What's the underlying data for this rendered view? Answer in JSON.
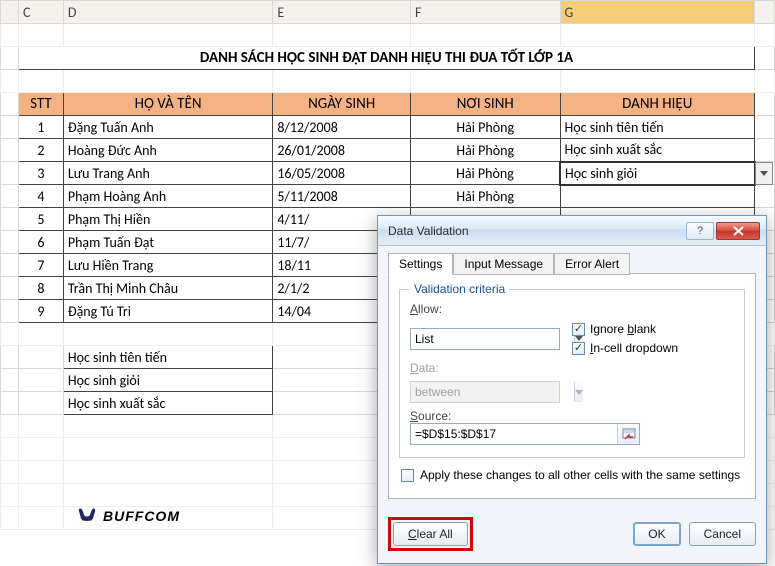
{
  "columns": {
    "C": "C",
    "D": "D",
    "E": "E",
    "F": "F",
    "G": "G"
  },
  "title": "DANH SÁCH HỌC SINH ĐẠT DANH HIỆU THI ĐUA TỐT LỚP 1A",
  "headers": {
    "stt": "STT",
    "name": "HỌ VÀ TÊN",
    "dob": "NGÀY SINH",
    "pob": "NƠI SINH",
    "award": "DANH HIỆU"
  },
  "rows": [
    {
      "stt": "1",
      "name": "Đặng Tuấn Anh",
      "dob": "8/12/2008",
      "pob": "Hải Phòng",
      "award": "Học sinh tiên tiến"
    },
    {
      "stt": "2",
      "name": "Hoàng Đức Anh",
      "dob": "26/01/2008",
      "pob": "Hải Phòng",
      "award": "Học sinh xuất sắc"
    },
    {
      "stt": "3",
      "name": "Lưu Trang Anh",
      "dob": "16/05/2008",
      "pob": "Hải Phòng",
      "award": "Học sinh giỏi"
    },
    {
      "stt": "4",
      "name": "Phạm Hoàng Anh",
      "dob": "5/11/2008",
      "pob": "Hải Phòng",
      "award": ""
    },
    {
      "stt": "5",
      "name": "Phạm Thị Hiền",
      "dob": "4/11/",
      "pob": "",
      "award": ""
    },
    {
      "stt": "6",
      "name": "Phạm Tuấn Đạt",
      "dob": "11/7/",
      "pob": "",
      "award": ""
    },
    {
      "stt": "7",
      "name": "Lưu Hiền Trang",
      "dob": "18/11",
      "pob": "",
      "award": ""
    },
    {
      "stt": "8",
      "name": "Trần Thị Minh Châu",
      "dob": "2/1/2",
      "pob": "",
      "award": ""
    },
    {
      "stt": "9",
      "name": "Đặng Tú Tri",
      "dob": "14/04",
      "pob": "",
      "award": ""
    }
  ],
  "list": [
    "Học sinh tiên tiến",
    "Học sinh giỏi",
    "Học sinh xuất sắc"
  ],
  "logo_text": "BUFFCOM",
  "dialog": {
    "title": "Data Validation",
    "tabs": {
      "settings": "Settings",
      "input": "Input Message",
      "error": "Error Alert"
    },
    "group": "Validation criteria",
    "allow_label": "Allow:",
    "allow_value": "List",
    "data_label": "Data:",
    "data_value": "between",
    "ignore": "Ignore blank",
    "incell": "In-cell dropdown",
    "source_label": "Source:",
    "source_value": "=$D$15:$D$17",
    "apply": "Apply these changes to all other cells with the same settings",
    "clear": "Clear All",
    "ok": "OK",
    "cancel": "Cancel"
  }
}
